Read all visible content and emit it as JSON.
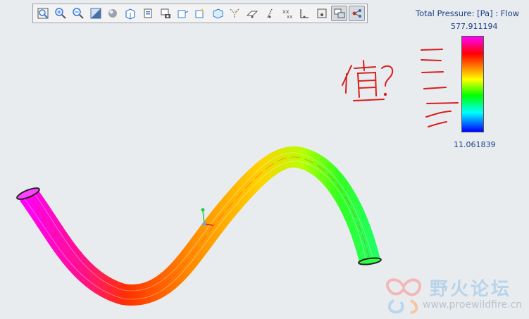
{
  "toolbar": {
    "buttons": [
      {
        "icon": "zoom-fit-icon"
      },
      {
        "icon": "zoom-in-icon"
      },
      {
        "icon": "zoom-out-icon"
      },
      {
        "icon": "refit-icon"
      },
      {
        "icon": "display-style-icon"
      },
      {
        "icon": "saved-views-icon"
      },
      {
        "icon": "layers-icon"
      },
      {
        "icon": "camera-icon"
      },
      {
        "icon": "datum-plane-icon"
      },
      {
        "icon": "datum-axis-icon"
      },
      {
        "icon": "datum-point-icon"
      },
      {
        "icon": "coordinate-system-icon"
      },
      {
        "icon": "annotation-icon"
      },
      {
        "icon": "spin-center-icon"
      },
      {
        "icon": "datum-display-icon"
      },
      {
        "icon": "point-display-icon"
      },
      {
        "icon": "csys-display-icon"
      },
      {
        "icon": "results-display-icon",
        "active": true
      },
      {
        "icon": "node-display-icon",
        "active": true
      }
    ]
  },
  "legend": {
    "title": "Total Pressure: [Pa] : Flow",
    "max": "577.911194",
    "min": "11.061839",
    "colors": [
      "#ff00ff",
      "#ff0000",
      "#ff8000",
      "#ffff00",
      "#00ff00",
      "#00ffff",
      "#0000ff"
    ]
  },
  "annotation": {
    "handwritten": "值?",
    "color": "#d81e1e"
  },
  "watermark": {
    "name": "野火论坛",
    "url": "www.proewildfire.cn"
  }
}
